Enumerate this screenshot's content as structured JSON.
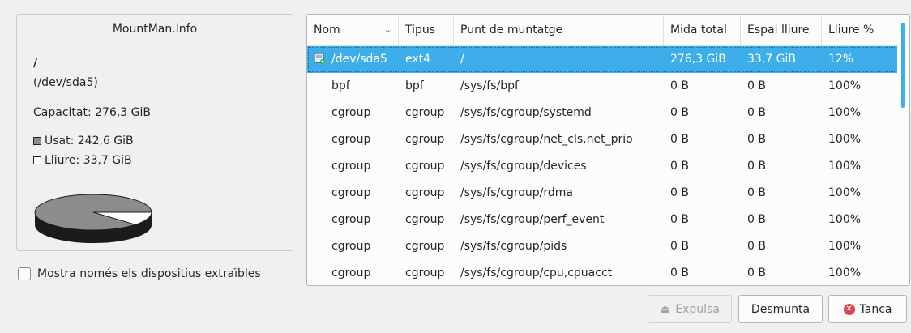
{
  "info": {
    "title": "MountMan.Info",
    "mount_point": "/",
    "device": "(/dev/sda5)",
    "capacity": "Capacitat: 276,3 GiB",
    "used": "Usat: 242,6 GiB",
    "free": "Lliure: 33,7 GiB",
    "used_fraction": 0.878
  },
  "checkbox": {
    "label": "Mostra només els dispositius extraïbles",
    "checked": false
  },
  "table": {
    "columns": [
      "Nom",
      "Tipus",
      "Punt de muntatge",
      "Mida total",
      "Espai lliure",
      "Lliure %"
    ],
    "rows": [
      {
        "name": "/dev/sda5",
        "type": "ext4",
        "mount": "/",
        "size": "276,3 GiB",
        "free": "33,7 GiB",
        "pct": "12%"
      },
      {
        "name": "bpf",
        "type": "bpf",
        "mount": "/sys/fs/bpf",
        "size": "0 B",
        "free": "0 B",
        "pct": "100%"
      },
      {
        "name": "cgroup",
        "type": "cgroup",
        "mount": "/sys/fs/cgroup/systemd",
        "size": "0 B",
        "free": "0 B",
        "pct": "100%"
      },
      {
        "name": "cgroup",
        "type": "cgroup",
        "mount": "/sys/fs/cgroup/net_cls,net_prio",
        "size": "0 B",
        "free": "0 B",
        "pct": "100%"
      },
      {
        "name": "cgroup",
        "type": "cgroup",
        "mount": "/sys/fs/cgroup/devices",
        "size": "0 B",
        "free": "0 B",
        "pct": "100%"
      },
      {
        "name": "cgroup",
        "type": "cgroup",
        "mount": "/sys/fs/cgroup/rdma",
        "size": "0 B",
        "free": "0 B",
        "pct": "100%"
      },
      {
        "name": "cgroup",
        "type": "cgroup",
        "mount": "/sys/fs/cgroup/perf_event",
        "size": "0 B",
        "free": "0 B",
        "pct": "100%"
      },
      {
        "name": "cgroup",
        "type": "cgroup",
        "mount": "/sys/fs/cgroup/pids",
        "size": "0 B",
        "free": "0 B",
        "pct": "100%"
      },
      {
        "name": "cgroup",
        "type": "cgroup",
        "mount": "/sys/fs/cgroup/cpu,cpuacct",
        "size": "0 B",
        "free": "0 B",
        "pct": "100%"
      }
    ]
  },
  "buttons": {
    "eject": "Expulsa",
    "unmount": "Desmunta",
    "close": "Tanca"
  },
  "colors": {
    "selection": "#3daee9",
    "close_icon": "#da4453",
    "pie_used": "#8c8c8c",
    "pie_free": "#ffffff"
  },
  "icons": {
    "sort": "chevron-down-icon",
    "disk": "disk-mounted-icon",
    "eject": "eject-icon",
    "close": "close-icon"
  }
}
